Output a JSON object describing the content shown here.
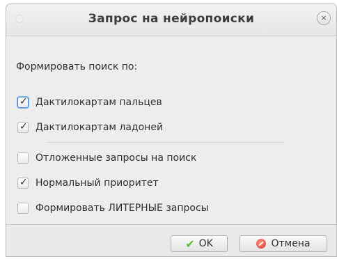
{
  "window": {
    "title": "Запрос на нейропоиски",
    "close_glyph": "×"
  },
  "form": {
    "section_label": "Формировать поиск по:",
    "options": [
      {
        "label": "Дактилокартам пальцев",
        "checked": true
      },
      {
        "label": "Дактилокартам ладоней",
        "checked": true
      },
      {
        "label": "Отложенные запросы на поиск",
        "checked": false
      },
      {
        "label": "Нормальный приоритет",
        "checked": true
      },
      {
        "label": "Формировать ЛИТЕРНЫЕ запросы",
        "checked": false
      }
    ]
  },
  "buttons": {
    "ok_label": "OK",
    "cancel_label": "Отмена"
  },
  "icons": {
    "ok": "check-icon",
    "cancel": "cancel-icon",
    "close": "close-icon"
  },
  "colors": {
    "ok_icon": "#5fb832",
    "cancel_icon": "#d83a2a",
    "focus": "#4a90d9"
  }
}
